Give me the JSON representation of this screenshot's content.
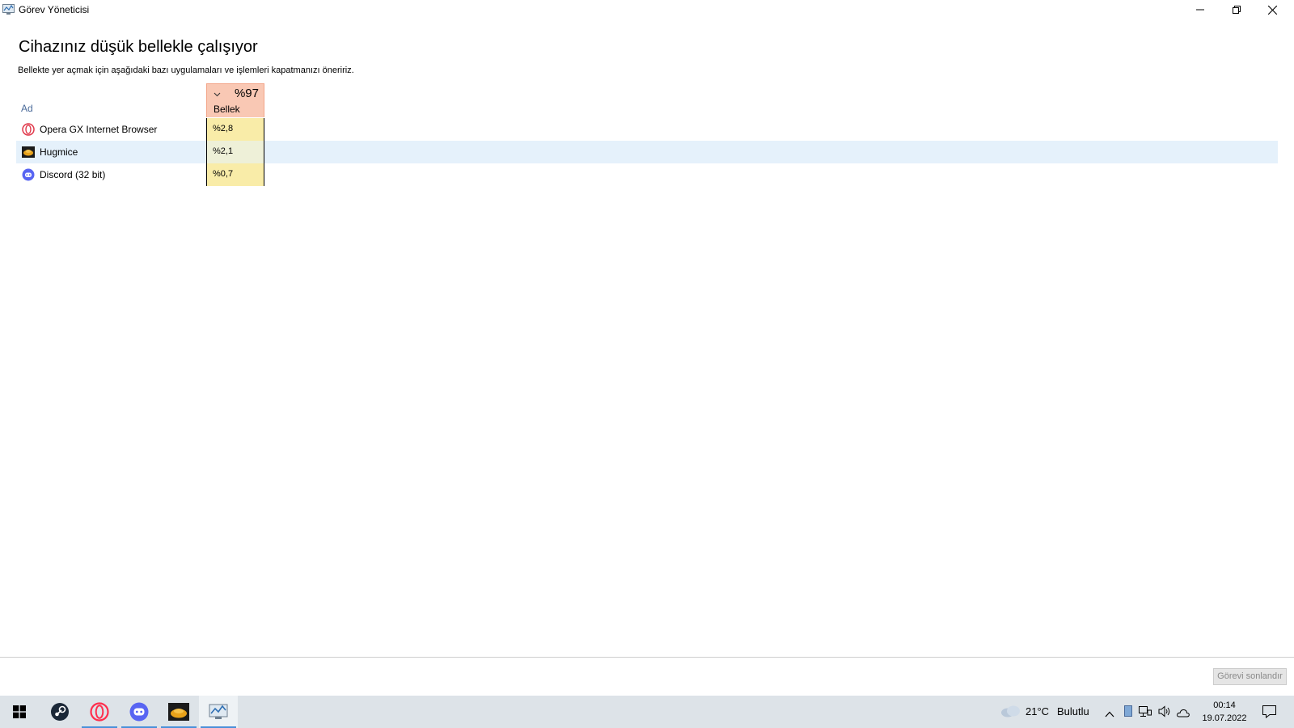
{
  "window": {
    "title": "Görev Yöneticisi"
  },
  "main": {
    "heading": "Cihazınız düşük bellekle çalışıyor",
    "subheading": "Bellekte yer açmak için aşağıdaki bazı uygulamaları ve işlemleri kapatmanızı öneririz."
  },
  "table": {
    "name_header": "Ad",
    "memory_header": {
      "percent": "%97",
      "label": "Bellek"
    },
    "rows": [
      {
        "name": "Opera GX Internet Browser",
        "memory": "%2,8",
        "icon": "opera-icon"
      },
      {
        "name": "Hugmice",
        "memory": "%2,1",
        "icon": "hugmice-icon",
        "selected": true
      },
      {
        "name": "Discord (32 bit)",
        "memory": "%0,7",
        "icon": "discord-icon"
      }
    ]
  },
  "footer": {
    "end_task_label": "Görevi sonlandır"
  },
  "taskbar": {
    "apps": [
      "start-icon",
      "steam-icon",
      "opera-icon",
      "discord-icon",
      "hugmice-icon",
      "task-manager-icon"
    ],
    "weather_temp": "21°C",
    "weather_desc": "Bulutlu",
    "time": "00:14",
    "date": "19.07.2022"
  },
  "colors": {
    "memory_header_bg": "#f9c8b4",
    "memory_cell_bg": "#f9eca8",
    "selected_row_bg": "#e5f1fb",
    "taskbar_bg": "#dde3e8",
    "accent": "#4a90d9"
  }
}
